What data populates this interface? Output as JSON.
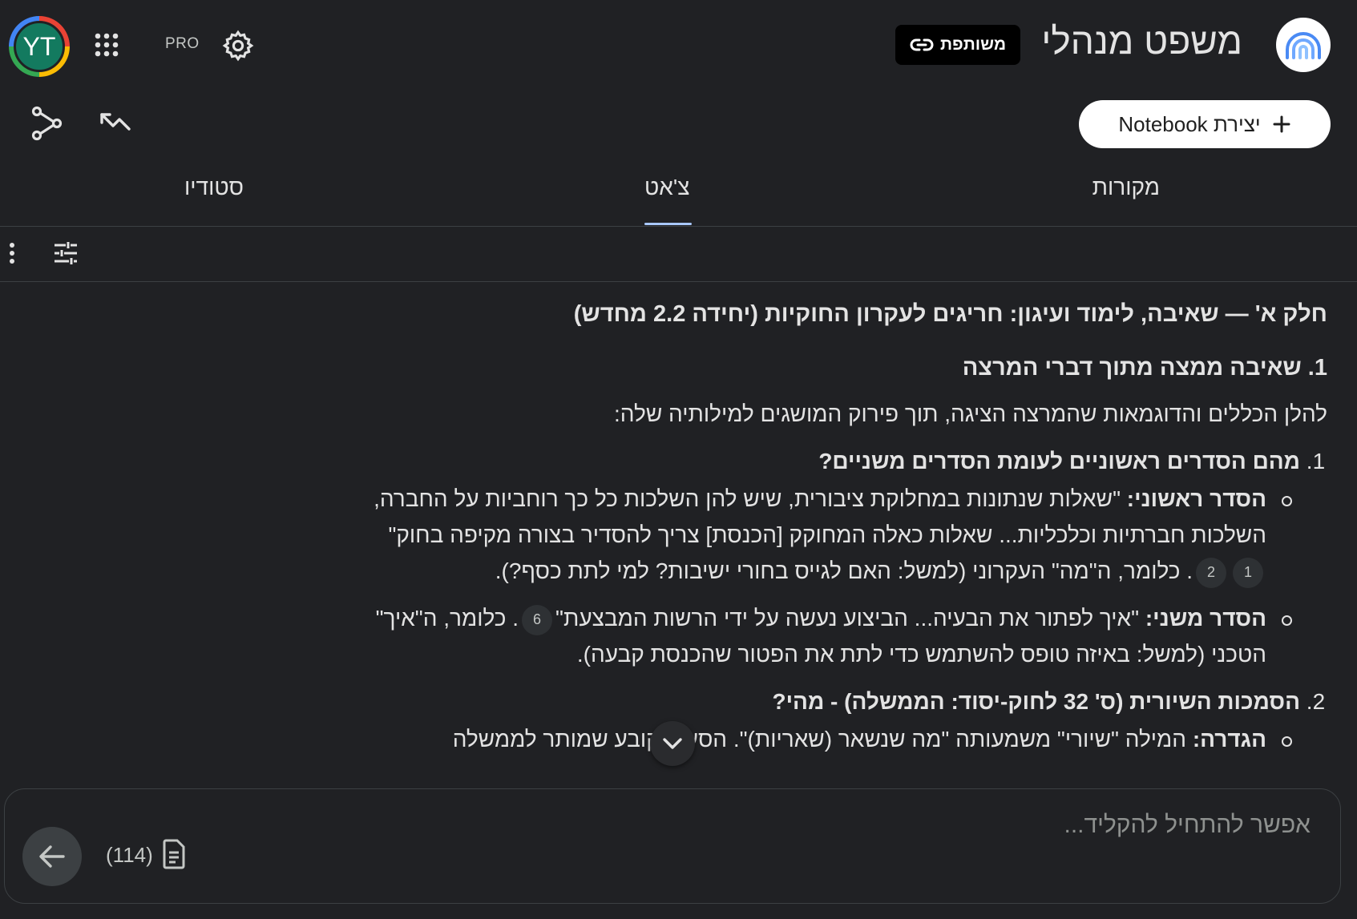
{
  "header": {
    "avatar_initials": "YT",
    "pro_label": "PRO",
    "share_label": "משותפת",
    "notebook_title": "משפט מנהלי",
    "create_label": "יצירת Notebook"
  },
  "tabs": {
    "sources": "מקורות",
    "chat": "צ'אט",
    "studio": "סטודיו"
  },
  "content": {
    "part_heading": "חלק א' — שאיבה, לימוד ועיגון: חריגים לעקרון החוקיות (יחידה 2.2 מחדש)",
    "section_heading": "1. שאיבה ממצה מתוך דברי המרצה",
    "intro": "להלן הכללים והדוגמאות שהמרצה הציגה, תוך פירוק המושגים למילותיה שלה:",
    "q1": "מהם הסדרים ראשוניים לעומת הסדרים משניים?",
    "primary_label": "הסדר ראשוני:",
    "primary_text_a": " \"שאלות שנתונות במחלוקת ציבורית, שיש להן השלכות כל כך רוחביות על החברה, השלכות חברתיות וכלכליות... שאלות כאלה המחוקק [הכנסת] צריך להסדיר בצורה מקיפה בחוק\"",
    "primary_text_b": ". כלומר, ה\"מה\" העקרוני (למשל: האם לגייס בחורי ישיבות? למי לתת כסף?).",
    "secondary_label": "הסדר משני:",
    "secondary_text_a": " \"איך לפתור את הבעיה... הביצוע נעשה על ידי הרשות המבצעת\"",
    "secondary_text_b": ". כלומר, ה\"איך\" הטכני (למשל: באיזה טופס להשתמש כדי לתת את הפטור שהכנסת קבעה).",
    "q2": "הסמכות השיורית (ס' 32 לחוק-יסוד: הממשלה) - מהי?",
    "definition_label": "הגדרה:",
    "definition_text": " המילה \"שיורי\" משמעותה \"מה שנשאר (שאריות)\". הסעיף קובע שמותר לממשלה",
    "citations": {
      "c1": "1",
      "c2": "2",
      "c6": "6"
    }
  },
  "input": {
    "placeholder": "אפשר להתחיל להקליד...",
    "source_count": "(114)"
  },
  "colors": {
    "background": "#202124",
    "accent": "#a8c7fa",
    "text": "#e3e3e3"
  },
  "icons": [
    "apps-grid-icon",
    "settings-gear-icon",
    "link-icon",
    "plus-icon",
    "share-nodes-icon",
    "collapse-arrow-icon",
    "tune-sliders-icon",
    "more-vert-icon",
    "chevron-down-icon",
    "source-doc-icon",
    "arrow-left-icon"
  ]
}
